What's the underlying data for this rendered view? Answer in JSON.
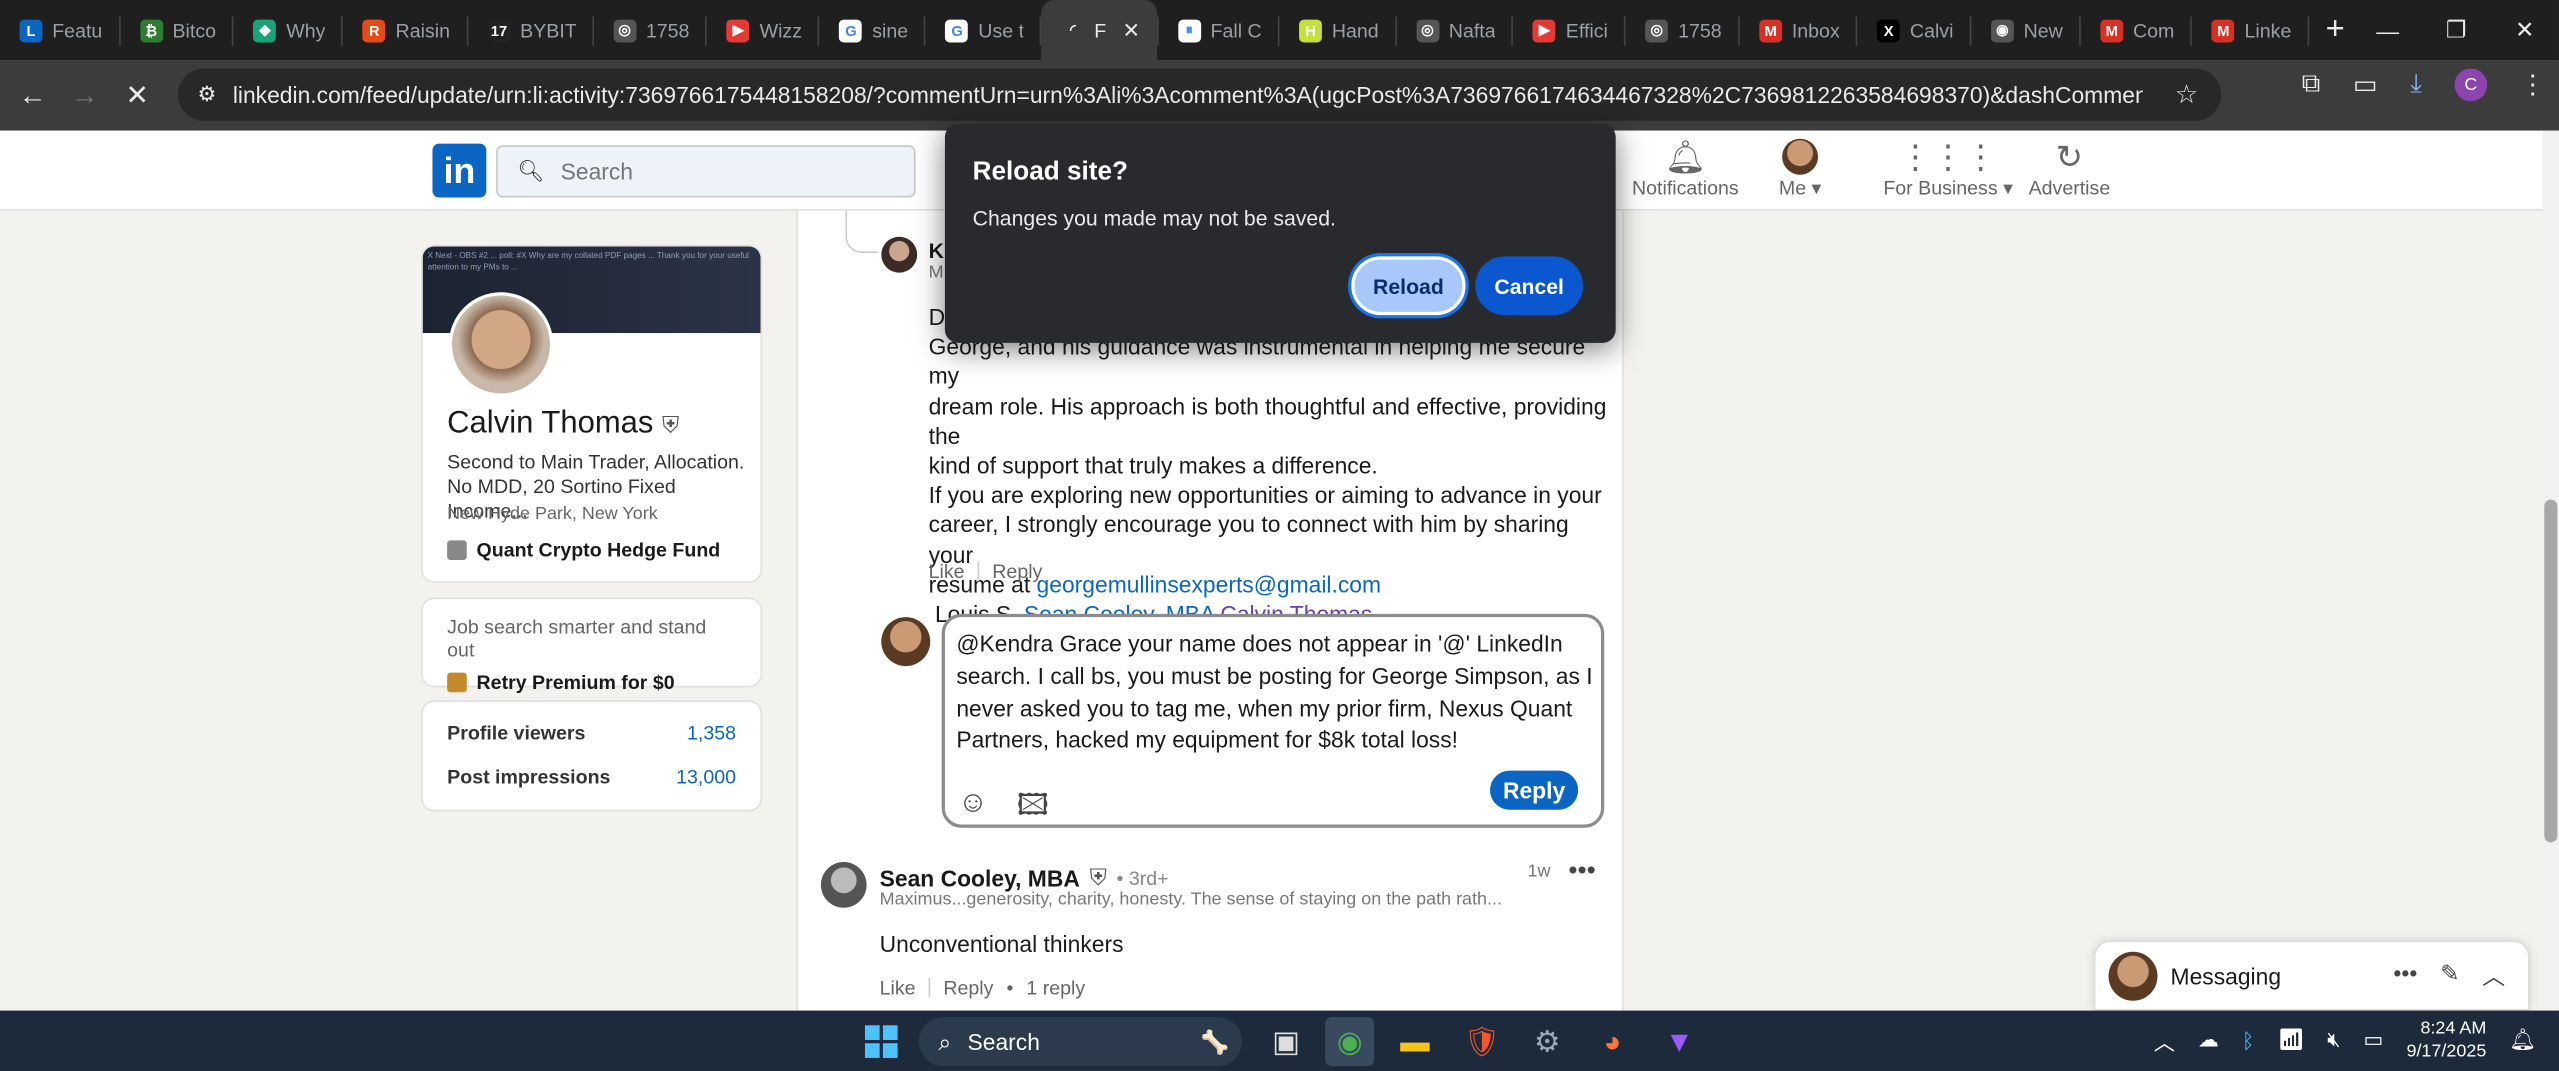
{
  "browser": {
    "tabs": [
      {
        "title": "Featu",
        "icon": "linkedin-icon",
        "color": "#0a66c2",
        "glyph": "L"
      },
      {
        "title": "Bitco",
        "icon": "crypto-icon",
        "color": "#2e7d32",
        "glyph": "₿"
      },
      {
        "title": "Why",
        "icon": "diamond-icon",
        "color": "#1aa37a",
        "glyph": "◆"
      },
      {
        "title": "Raisin",
        "icon": "raisin-icon",
        "color": "#e64a19",
        "glyph": "R"
      },
      {
        "title": "BYBIT",
        "icon": "tv-icon",
        "color": "#222",
        "glyph": "17"
      },
      {
        "title": "1758",
        "icon": "globe-icon",
        "color": "#555",
        "glyph": "◎"
      },
      {
        "title": "Wizz",
        "icon": "youtube-icon",
        "color": "#e53935",
        "glyph": "▶"
      },
      {
        "title": "sine",
        "icon": "google-icon",
        "color": "#fff",
        "glyph": "G"
      },
      {
        "title": "Use t",
        "icon": "google-icon",
        "color": "#fff",
        "glyph": "G"
      },
      {
        "title": "F",
        "icon": "loading-icon",
        "color": "#3c3c3c",
        "glyph": "◜"
      },
      {
        "title": "Fall C",
        "icon": "pause-icon",
        "color": "#fff",
        "glyph": "⏸"
      },
      {
        "title": "Hand",
        "icon": "hand-icon",
        "color": "#c6e03a",
        "glyph": "H"
      },
      {
        "title": "Nafta",
        "icon": "globe-icon",
        "color": "#555",
        "glyph": "◎"
      },
      {
        "title": "Effici",
        "icon": "youtube-icon",
        "color": "#e53935",
        "glyph": "▶"
      },
      {
        "title": "1758",
        "icon": "globe-icon",
        "color": "#555",
        "glyph": "◎"
      },
      {
        "title": "Inbox",
        "icon": "gmail-icon",
        "color": "#d93025",
        "glyph": "M"
      },
      {
        "title": "Calvi",
        "icon": "x-icon",
        "color": "#000",
        "glyph": "X"
      },
      {
        "title": "New",
        "icon": "chrome-icon",
        "color": "#555",
        "glyph": "◉"
      },
      {
        "title": "Com",
        "icon": "gmail-icon",
        "color": "#d93025",
        "glyph": "M"
      },
      {
        "title": "Linke",
        "icon": "gmail-icon",
        "color": "#d93025",
        "glyph": "M"
      }
    ],
    "url": "linkedin.com/feed/update/urn:li:activity:7369766175448158208/?commentUrn=urn%3Ali%3Acomment%3A(ugcPost%3A7369766174634467328%2C7369812263584698370)&dashCommentUrn=urn%3Ali%..."
  },
  "header": {
    "search_placeholder": "Search",
    "notifications": "Notifications",
    "me": "Me",
    "for_business": "For Business",
    "advertise": "Advertise"
  },
  "profile": {
    "banner_text": "X Next - OBS #2 ... poll: #X Why are my collated PDF pages ... Thank you for your useful attention to my PMs to ...",
    "name": "Calvin Thomas",
    "headline": "Second to Main Trader, Allocation. No MDD, 20 Sortino Fixed Income...",
    "location": "New Hyde Park, New York",
    "org": "Quant Crypto Hedge Fund"
  },
  "premium": {
    "line1": "Job search smarter and stand out",
    "line2": "Retry Premium for $0"
  },
  "stats": [
    {
      "label": "Profile viewers",
      "value": "1,358"
    },
    {
      "label": "Post impressions",
      "value": "13,000"
    }
  ],
  "comment": {
    "author_initial": "K",
    "line_partial_1": "D",
    "line_partial_2": "M",
    "line1": "George, and his guidance was instrumental in helping me secure my",
    "line2": "dream role. His approach is both thoughtful and effective, providing the",
    "line3": "kind of support that truly makes a difference.",
    "line4": "If you are exploring new opportunities or aiming to advance in your",
    "line5": "career, I strongly encourage you to connect with him by sharing your",
    "line6_prefix": "resume at ",
    "email": "georgemullinsexperts@gmail.com",
    "line7_prefix": " Louis S. ",
    "mention1": "Sean Cooley, MBA",
    "mention2": "Calvin Thomas",
    "like": "Like",
    "reply": "Reply"
  },
  "reply_box": {
    "text": "@Kendra Grace your name does not appear in '@' LinkedIn search. I call bs, you must be posting for George Simpson, as I never asked you to tag me, when my prior firm, Nexus Quant Partners, hacked my equipment for $8k total loss!",
    "button": "Reply"
  },
  "second_comment": {
    "name": "Sean Cooley, MBA",
    "degree": "• 3rd+",
    "headline": "Maximus...generosity, charity, honesty. The sense of staying on the path rath...",
    "time": "1w",
    "body": "Unconventional thinkers",
    "like": "Like",
    "reply": "Reply",
    "replies": "1 reply"
  },
  "messaging": {
    "label": "Messaging"
  },
  "dialog": {
    "title": "Reload site?",
    "message": "Changes you made may not be saved.",
    "reload": "Reload",
    "cancel": "Cancel"
  },
  "taskbar": {
    "search": "Search",
    "time": "8:24 AM",
    "date": "9/17/2025"
  }
}
